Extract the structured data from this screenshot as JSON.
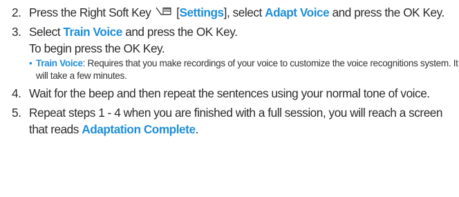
{
  "accent_color": "#1f8fd9",
  "clipped_top_text": "",
  "steps": [
    {
      "number": "2.",
      "text_before": "Press the Right Soft Key",
      "icon": "right-soft-key-icon",
      "bracket_open": " [",
      "kw1": "Settings",
      "text_mid": "], select ",
      "kw2": "Adapt Voice",
      "text_after": " and press the OK Key."
    },
    {
      "number": "3.",
      "text_before": "Select ",
      "kw1": "Train Voice",
      "text_after": " and press the OK Key.",
      "subline": "To begin press the OK Key.",
      "bullet": {
        "marker": "•",
        "kw": "Train Voice",
        "text": ": Requires that you make recordings of your voice to customize the voice recognitions system. It will take a few minutes."
      }
    },
    {
      "number": "4.",
      "text": "Wait for the beep and then repeat the sentences using your normal tone of voice."
    },
    {
      "number": "5.",
      "text_before": "Repeat steps 1 - 4 when you are finished with a full session, you will reach a screen that reads ",
      "kw1": "Adaptation Complete",
      "text_after": "."
    }
  ]
}
